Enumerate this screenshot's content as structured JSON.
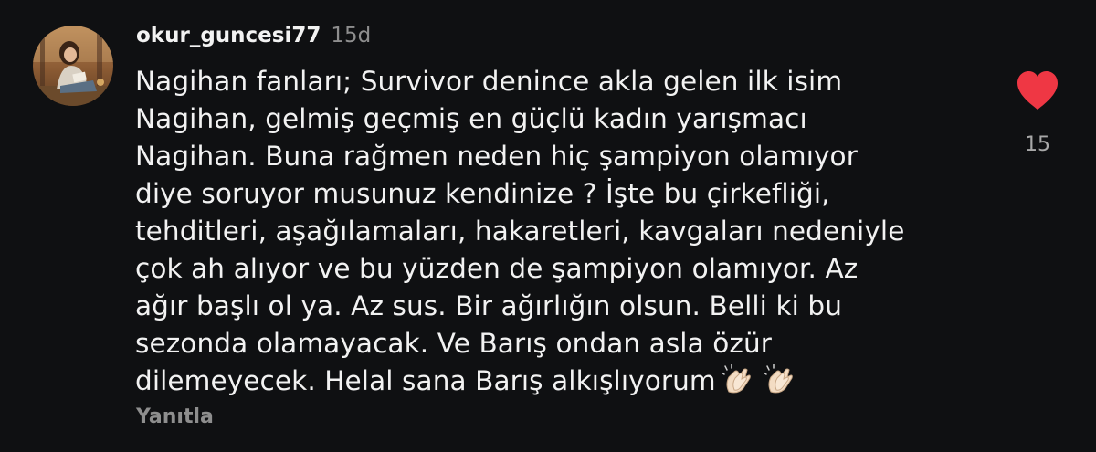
{
  "comment": {
    "username": "okur_guncesi77",
    "time_ago": "15d",
    "text_lines": [
      "Nagihan fanları; Survivor denince akla gelen ilk isim",
      "Nagihan, gelmiş geçmiş en güçlü kadın yarışmacı",
      "Nagihan. Buna rağmen neden hiç şampiyon olamıyor",
      "diye soruyor musunuz kendinize ? İşte bu çirkefliği,",
      "tehditleri, aşağılamaları, hakaretleri, kavgaları nedeniyle",
      "çok ah alıyor ve bu yüzden de şampiyon olamıyor. Az",
      "ağır başlı ol ya. Az sus. Bir ağırlığın olsun. Belli ki bu",
      "sezonda olamayacak. Ve Barış ondan asla özür",
      "dilemeyecek. Helal sana Barış alkışlıyorum"
    ],
    "emojis": [
      "clapping-hands-icon",
      "clapping-hands-icon"
    ],
    "reply_label": "Yanıtla",
    "like_count": "15",
    "liked": true
  },
  "colors": {
    "background": "#0f1012",
    "text": "#f2f2f2",
    "muted": "#8e8e8e",
    "heart": "#ef3744"
  }
}
